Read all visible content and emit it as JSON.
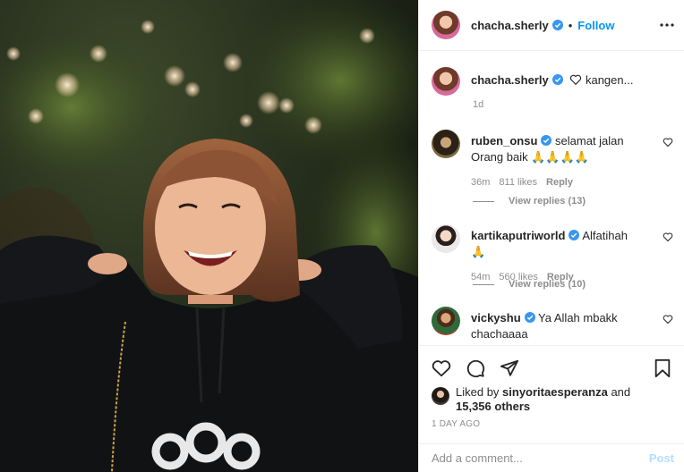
{
  "post": {
    "author": "chacha.sherly",
    "follow_label": "Follow",
    "separator": "•",
    "caption_author": "chacha.sherly",
    "caption_text": "kangen...",
    "caption_time": "1d"
  },
  "comments": [
    {
      "user": "ruben_onsu",
      "text_line1": "selamat jalan",
      "text_line2": "Orang baik 🙏🙏🙏🙏",
      "time": "36m",
      "likes": "811 likes",
      "reply_label": "Reply",
      "replies": "View replies (13)"
    },
    {
      "user": "kartikaputriworld",
      "text_line1": "Alfatihah🙏",
      "time": "54m",
      "likes": "560 likes",
      "reply_label": "Reply",
      "replies": "View replies (10)"
    },
    {
      "user": "vickyshu",
      "text_line1": "Ya Allah mbakk",
      "text_line2": "chachaaaa"
    }
  ],
  "likes": {
    "liked_by_prefix": "Liked by",
    "liked_by_user": "sinyoritaesperanza",
    "and": "and",
    "others": "15,356 others"
  },
  "date": "1 DAY AGO",
  "add_comment": {
    "placeholder": "Add a comment...",
    "post_label": "Post"
  },
  "colors": {
    "accent": "#0095f6",
    "verified": "#3897f0",
    "muted": "#8e8e8e"
  }
}
